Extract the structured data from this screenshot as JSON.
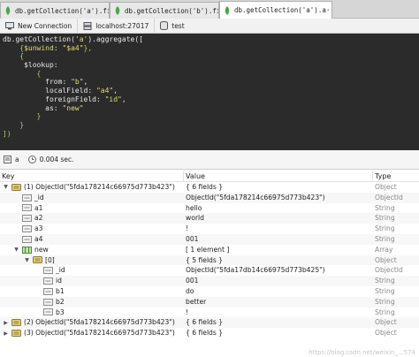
{
  "tabs": [
    {
      "label": "db.getCollection('a').fi···",
      "active": false
    },
    {
      "label": "db.getCollection('b').fi···",
      "active": false
    },
    {
      "label": "db.getCollection('a').a···",
      "active": true
    }
  ],
  "tab_close": "×",
  "connection": {
    "name": "New Connection",
    "host": "localhost:27017",
    "db": "test"
  },
  "editor_lines": [
    [
      {
        "t": "db.getCollection(",
        "c": "kw"
      },
      {
        "t": "'a'",
        "c": "str"
      },
      {
        "t": ").aggregate([",
        "c": "kw"
      }
    ],
    [
      {
        "t": "    {",
        "c": "brace"
      },
      {
        "t": "$unwind",
        "c": "key"
      },
      {
        "t": ": ",
        "c": "kw"
      },
      {
        "t": "\"$a4\"",
        "c": "str"
      },
      {
        "t": "},",
        "c": "brace"
      }
    ],
    [
      {
        "t": "    {",
        "c": "brace"
      }
    ],
    [
      {
        "t": "     $lookup",
        "c": "kw"
      },
      {
        "t": ":",
        "c": "kw"
      }
    ],
    [
      {
        "t": "        {",
        "c": "brace"
      }
    ],
    [
      {
        "t": "          from",
        "c": "kw"
      },
      {
        "t": ": ",
        "c": "kw"
      },
      {
        "t": "\"b\"",
        "c": "str"
      },
      {
        "t": ",",
        "c": "kw"
      }
    ],
    [
      {
        "t": "          localField",
        "c": "kw"
      },
      {
        "t": ": ",
        "c": "kw"
      },
      {
        "t": "\"a4\"",
        "c": "str"
      },
      {
        "t": ",",
        "c": "kw"
      }
    ],
    [
      {
        "t": "          foreignField",
        "c": "kw"
      },
      {
        "t": ": ",
        "c": "kw"
      },
      {
        "t": "\"id\"",
        "c": "str"
      },
      {
        "t": ",",
        "c": "kw"
      }
    ],
    [
      {
        "t": "          as",
        "c": "kw"
      },
      {
        "t": ": ",
        "c": "kw"
      },
      {
        "t": "\"new\"",
        "c": "str"
      }
    ],
    [
      {
        "t": "        }",
        "c": "brace"
      }
    ],
    [
      {
        "t": "    }",
        "c": "brace"
      }
    ],
    [
      {
        "t": "])",
        "c": "brace"
      }
    ]
  ],
  "status": {
    "collection": "a",
    "time": "0.004 sec."
  },
  "table": {
    "headers": {
      "key": "Key",
      "value": "Value",
      "type": "Type"
    },
    "rows": [
      {
        "indent": 0,
        "arrow": "▼",
        "icon": "document-icon",
        "key": "(1) ObjectId(\"5fda178214c66975d773b423\")",
        "value": "{ 6 fields }",
        "type": "Object"
      },
      {
        "indent": 1,
        "arrow": "",
        "icon": "field-icon",
        "key": "_id",
        "value": "ObjectId(\"5fda178214c66975d773b423\")",
        "type": "ObjectId"
      },
      {
        "indent": 1,
        "arrow": "",
        "icon": "field-icon",
        "key": "a1",
        "value": "hello",
        "type": "String"
      },
      {
        "indent": 1,
        "arrow": "",
        "icon": "field-icon",
        "key": "a2",
        "value": "world",
        "type": "String"
      },
      {
        "indent": 1,
        "arrow": "",
        "icon": "field-icon",
        "key": "a3",
        "value": "!",
        "type": "String"
      },
      {
        "indent": 1,
        "arrow": "",
        "icon": "field-icon",
        "key": "a4",
        "value": "001",
        "type": "String"
      },
      {
        "indent": 1,
        "arrow": "▼",
        "icon": "array-icon",
        "key": "new",
        "value": "[ 1 element ]",
        "type": "Array"
      },
      {
        "indent": 2,
        "arrow": "▼",
        "icon": "document-icon",
        "key": "[0]",
        "value": "{ 5 fields }",
        "type": "Object"
      },
      {
        "indent": 3,
        "arrow": "",
        "icon": "field-icon",
        "key": "_id",
        "value": "ObjectId(\"5fda17db14c66975d773b425\")",
        "type": "ObjectId"
      },
      {
        "indent": 3,
        "arrow": "",
        "icon": "field-icon",
        "key": "id",
        "value": "001",
        "type": "String"
      },
      {
        "indent": 3,
        "arrow": "",
        "icon": "field-icon",
        "key": "b1",
        "value": "do",
        "type": "String"
      },
      {
        "indent": 3,
        "arrow": "",
        "icon": "field-icon",
        "key": "b2",
        "value": "better",
        "type": "String"
      },
      {
        "indent": 3,
        "arrow": "",
        "icon": "field-icon",
        "key": "b3",
        "value": "!",
        "type": "String"
      },
      {
        "indent": 0,
        "arrow": "▶",
        "icon": "document-icon",
        "key": "(2) ObjectId(\"5fda178214c66975d773b423\")",
        "value": "{ 6 fields }",
        "type": "Object"
      },
      {
        "indent": 0,
        "arrow": "▶",
        "icon": "document-icon",
        "key": "(3) ObjectId(\"5fda178214c66975d773b423\")",
        "value": "{ 6 fields }",
        "type": "Object"
      }
    ]
  },
  "watermark": "https://blog.csdn.net/weixin_...574",
  "colors": {
    "editor_bg": "#2b2b2b",
    "string": "#e6db74",
    "brace": "#9bd84a",
    "leaf_green": "#4aa54a"
  }
}
